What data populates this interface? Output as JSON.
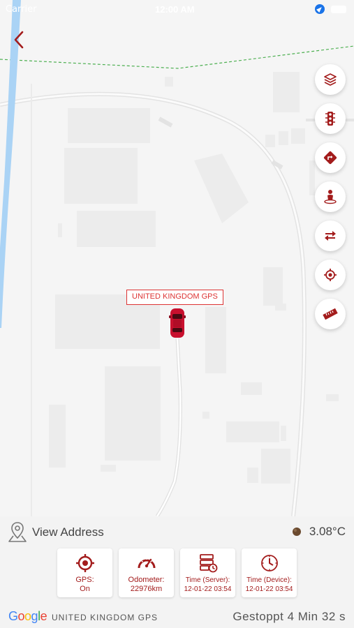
{
  "status_bar": {
    "carrier": "Carrier",
    "time": "12:00 AM"
  },
  "map": {
    "vehicle_label": "UNITED KINGDOM GPS",
    "controls": [
      {
        "name": "layers-button",
        "icon": "layers-icon"
      },
      {
        "name": "traffic-button",
        "icon": "traffic-light-icon"
      },
      {
        "name": "directions-button",
        "icon": "directions-icon"
      },
      {
        "name": "street-view-button",
        "icon": "person-icon"
      },
      {
        "name": "swap-button",
        "icon": "swap-arrows-icon"
      },
      {
        "name": "my-location-button",
        "icon": "crosshair-icon"
      },
      {
        "name": "measure-button",
        "icon": "ruler-icon"
      }
    ]
  },
  "info": {
    "address_label": "View Address",
    "temperature": "3.08°C",
    "cards": {
      "gps": {
        "label": "GPS:",
        "value": "On"
      },
      "odometer": {
        "label": "Odometer:",
        "value": "22976km"
      },
      "time_server": {
        "label": "Time (Server):",
        "value": "12-01-22 03:54"
      },
      "time_device": {
        "label": "Time (Device):",
        "value": "12-01-22 03:54"
      }
    }
  },
  "footer": {
    "google_letters": [
      "G",
      "o",
      "o",
      "g",
      "l",
      "e"
    ],
    "company": "UNITED KINGDOM GPS",
    "status": "Gestoppt 4 Min 32 s"
  },
  "colors": {
    "accent": "#a31c1c",
    "label_red": "#dd3333",
    "river": "#aad3f5",
    "map_bg": "#f5f5f5"
  }
}
